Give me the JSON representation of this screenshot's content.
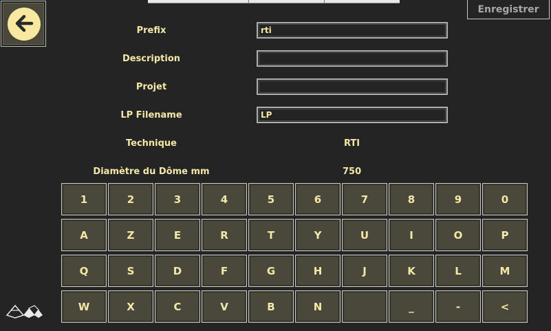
{
  "header": {
    "save_label": "Enregistrer"
  },
  "form": {
    "prefix_label": "Prefix",
    "prefix_value": "rti",
    "description_label": "Description",
    "description_value": "",
    "projet_label": "Projet",
    "projet_value": "",
    "lp_filename_label": "LP Filename",
    "lp_filename_value": "LP",
    "technique_label": "Technique",
    "technique_value": "RTI",
    "dome_label": "Diamètre du Dôme mm",
    "dome_value": "750"
  },
  "keyboard": {
    "rows": [
      [
        "1",
        "2",
        "3",
        "4",
        "5",
        "6",
        "7",
        "8",
        "9",
        "0"
      ],
      [
        "A",
        "Z",
        "E",
        "R",
        "T",
        "Y",
        "U",
        "I",
        "O",
        "P"
      ],
      [
        "Q",
        "S",
        "D",
        "F",
        "G",
        "H",
        "J",
        "K",
        "L",
        "M"
      ],
      [
        "W",
        "X",
        "C",
        "V",
        "B",
        "N",
        "",
        "_",
        "-",
        "<"
      ]
    ]
  },
  "icons": {
    "back": "arrow-left-icon",
    "logo": "brand-logo-icon"
  },
  "colors": {
    "background": "#242424",
    "text": "#f4e8a8",
    "key_bg": "#4a483a",
    "back_circle": "#f8e8a0"
  }
}
